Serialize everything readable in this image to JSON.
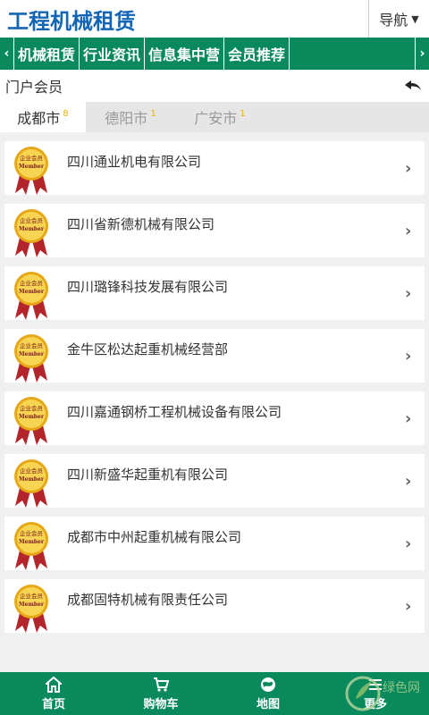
{
  "header": {
    "title": "工程机械租赁",
    "nav_label": "导航"
  },
  "navbar": {
    "items": [
      "机械租赁",
      "行业资讯",
      "信息集中营",
      "会员推荐"
    ]
  },
  "section": {
    "title": "门户会员"
  },
  "cities": [
    {
      "name": "成都市",
      "count": "8"
    },
    {
      "name": "德阳市",
      "count": "1"
    },
    {
      "name": "广安市",
      "count": "1"
    }
  ],
  "badge": {
    "top": "企业会员",
    "middle": "Member"
  },
  "companies": [
    "四川通业机电有限公司",
    "四川省新德机械有限公司",
    "四川璐锋科技发展有限公司",
    "金牛区松达起重机械经营部",
    "四川嘉通钢桥工程机械设备有限公司",
    "四川新盛华起重机有限公司",
    "成都市中州起重机械有限公司",
    "成都固特机械有限责任公司"
  ],
  "tabbar": [
    "首页",
    "购物车",
    "地图",
    "更多"
  ],
  "watermark": "绿色网",
  "colors": {
    "brand_green": "#0a8a5c",
    "title_blue": "#1565b5",
    "badge_gold": "#f2c21a",
    "ribbon_red": "#b3252b"
  }
}
